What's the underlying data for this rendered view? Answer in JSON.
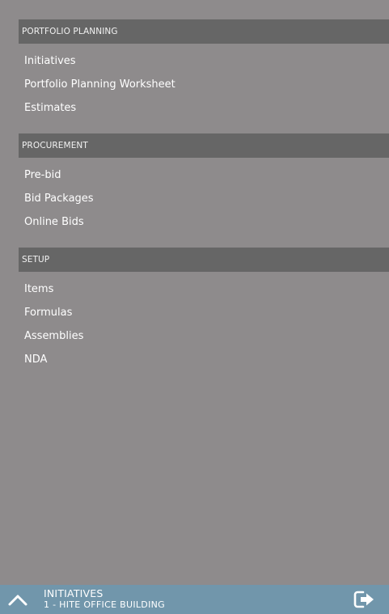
{
  "menu": {
    "sections": [
      {
        "title": "PORTFOLIO PLANNING",
        "items": [
          "Initiatives",
          "Portfolio Planning Worksheet",
          "Estimates"
        ]
      },
      {
        "title": "PROCUREMENT",
        "items": [
          "Pre-bid",
          "Bid Packages",
          "Online Bids"
        ]
      },
      {
        "title": "SETUP",
        "items": [
          "Items",
          "Formulas",
          "Assemblies",
          "NDA"
        ]
      }
    ]
  },
  "footer": {
    "title": "INITIATIVES",
    "subtitle": "1 - HITE OFFICE BUILDING",
    "collapse_icon": "chevron-up-icon",
    "exit_icon": "sign-out-icon"
  },
  "colors": {
    "panel_background": "#8e8b8c",
    "section_header": "#666666",
    "footer_background": "#7196ab"
  }
}
